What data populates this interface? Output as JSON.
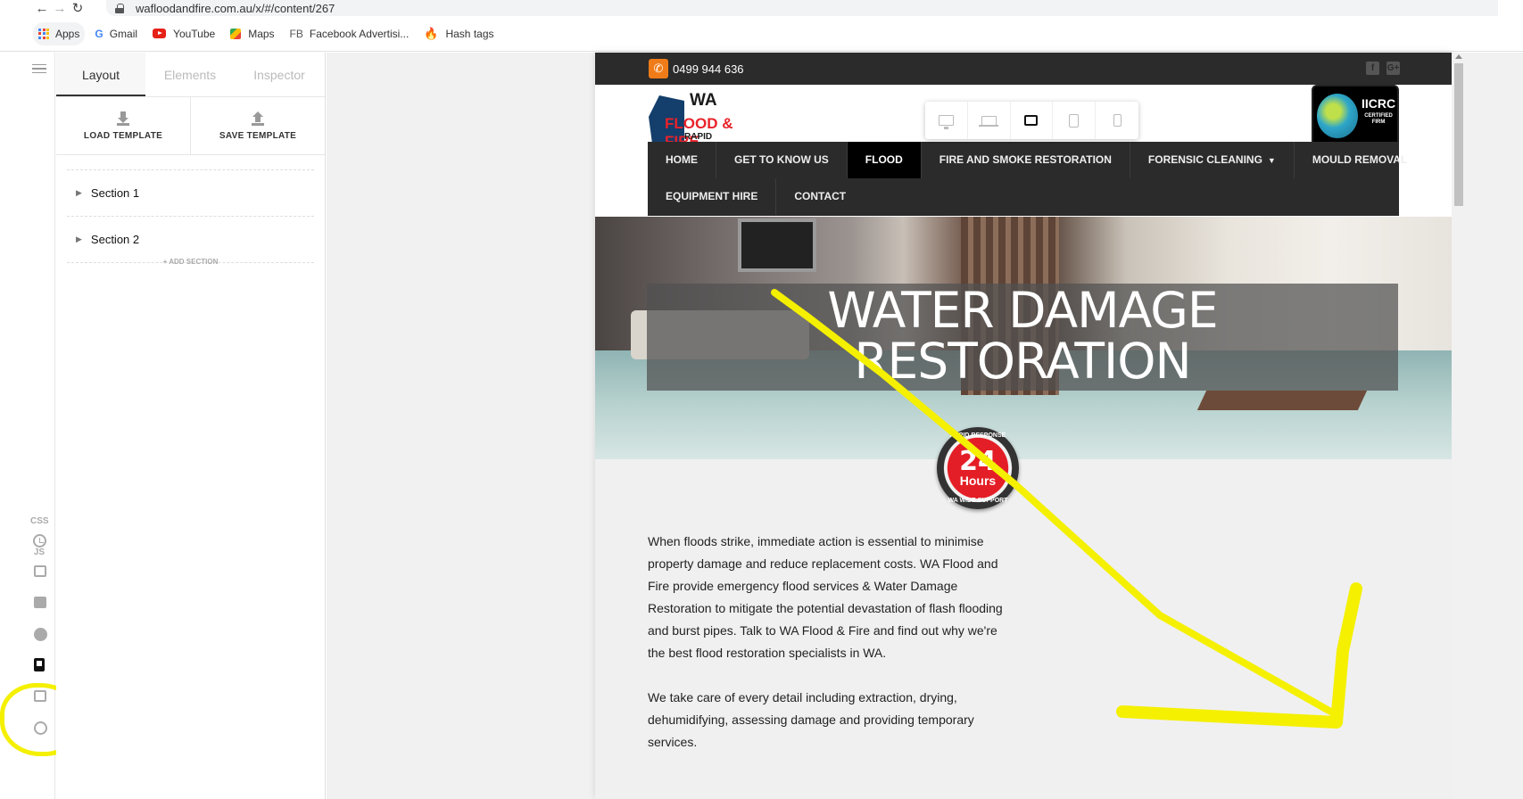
{
  "browser": {
    "url": "wafloodandfire.com.au/x/#/content/267",
    "bookmarks": {
      "apps": "Apps",
      "gmail": "Gmail",
      "youtube": "YouTube",
      "maps": "Maps",
      "facebook_prefix": "FB",
      "facebook": "Facebook Advertisi...",
      "hashtags": "Hash tags"
    }
  },
  "editor": {
    "rail": {
      "css": "CSS",
      "js": "JS"
    },
    "tabs": [
      "Layout",
      "Elements",
      "Inspector"
    ],
    "load_template": "LOAD TEMPLATE",
    "save_template": "SAVE TEMPLATE",
    "sections": [
      "Section 1",
      "Section 2"
    ],
    "add_section": "+ ADD SECTION"
  },
  "site": {
    "phone": "0499 944 636",
    "social": [
      "f",
      "G+"
    ],
    "logo": {
      "line1": "WA",
      "line2": "FLOOD & FIRE",
      "line3": "RAPID RESPONSE"
    },
    "iicrc": {
      "name": "IICRC",
      "sub1": "CERTIFIED",
      "sub2": "FIRM"
    },
    "nav_row1": [
      "HOME",
      "GET TO KNOW US",
      "FLOOD",
      "FIRE AND SMOKE RESTORATION",
      "FORENSIC CLEANING",
      "MOULD REMOVAL"
    ],
    "nav_row2": [
      "EQUIPMENT HIRE",
      "CONTACT"
    ],
    "active_nav": "FLOOD",
    "hero_line1": "WATER DAMAGE",
    "hero_line2": "RESTORATION",
    "badge": {
      "top": "RAPID RESPONSE",
      "number": "24",
      "unit": "Hours",
      "bottom": "WA WIDE SUPPORT"
    },
    "para1": "When floods strike, immediate action is essential to minimise property damage and reduce replacement costs. WA Flood and Fire provide emergency flood services & Water Damage Restoration to mitigate the potential devastation of flash flooding and burst pipes. Talk to WA Flood & Fire and find out why we're the best flood restoration specialists in WA.",
    "para2": "We take care of every detail including extraction, drying, dehumidifying, assessing damage and providing temporary services."
  },
  "colors": {
    "accent_orange": "#f07c19",
    "nav_dark": "#2b2b2b",
    "annotation_yellow": "#f4f000",
    "logo_red": "#e8222a"
  }
}
